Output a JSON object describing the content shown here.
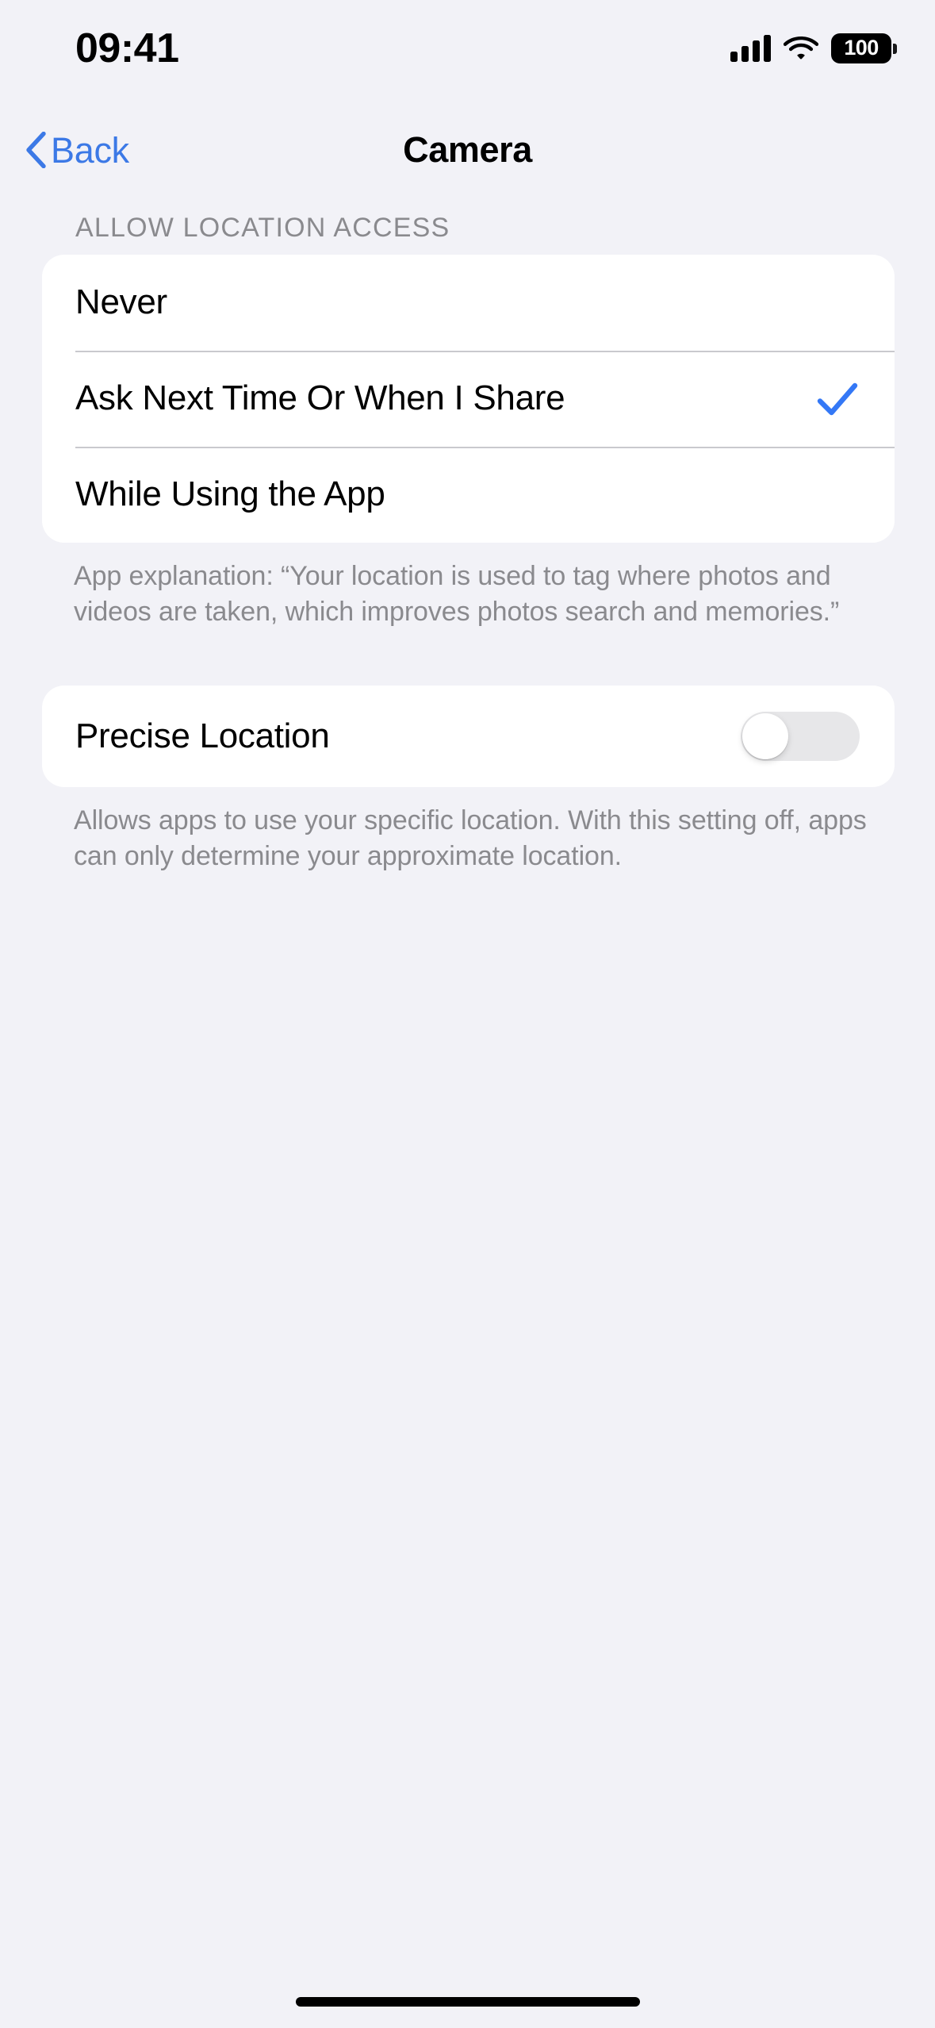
{
  "status_bar": {
    "time": "09:41",
    "cellular_icon": "cellular-bars-icon",
    "wifi_icon": "wifi-icon",
    "battery_percent": "100",
    "battery_icon": "battery-full-icon"
  },
  "nav_bar": {
    "back_label": "Back",
    "back_icon": "chevron-left-icon",
    "title": "Camera"
  },
  "location_section": {
    "header": "ALLOW LOCATION ACCESS",
    "options": [
      {
        "label": "Never",
        "selected": false
      },
      {
        "label": "Ask Next Time Or When I Share",
        "selected": true
      },
      {
        "label": "While Using the App",
        "selected": false
      }
    ],
    "check_icon": "checkmark-icon",
    "footer": "App explanation: “Your location is used to tag where photos and videos are taken, which improves photos search and memories.”"
  },
  "precise_section": {
    "label": "Precise Location",
    "toggle_state": "off",
    "footer": "Allows apps to use your specific location. With this setting off, apps can only determine your approximate location."
  },
  "colors": {
    "background": "#F2F2F7",
    "card": "#FFFFFF",
    "accent_blue": "#3C79E6",
    "checkmark_blue": "#3478F6",
    "secondary_text": "#8A8A8E",
    "separator": "#C9C9CE",
    "toggle_off_track": "#E7E7E9"
  },
  "home_indicator": "home-indicator"
}
